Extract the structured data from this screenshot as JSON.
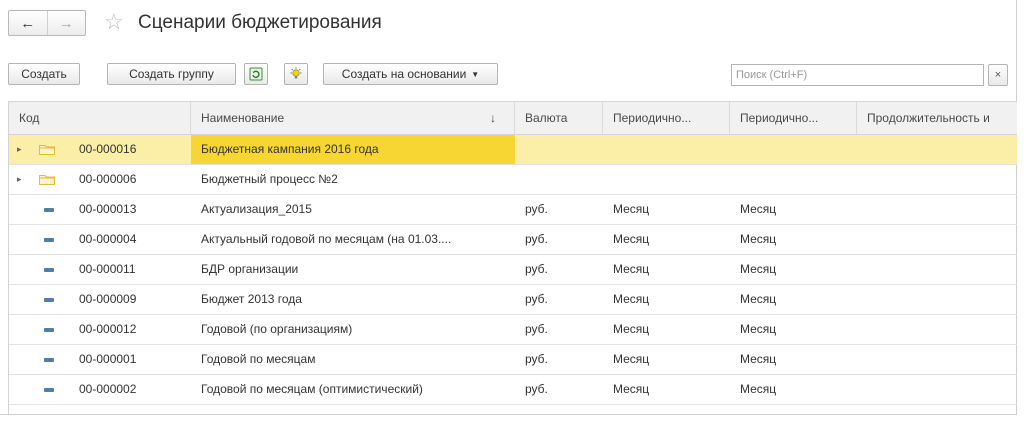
{
  "window": {
    "title": "Сценарии бюджетирования",
    "nav": {
      "back_label": "←",
      "forward_label": "→"
    }
  },
  "toolbar": {
    "create_label": "Создать",
    "create_group_label": "Создать группу",
    "create_based_on_label": "Создать на основании",
    "search_placeholder": "Поиск (Ctrl+F)",
    "search_clear_label": "×"
  },
  "table": {
    "columns": {
      "code": "Код",
      "name": "Наименование",
      "currency": "Валюта",
      "period1": "Периодично...",
      "period2": "Периодично...",
      "duration": "Продолжительность и"
    },
    "sort_indicator": "↓",
    "rows": [
      {
        "type": "group",
        "code": "00-000016",
        "name": "Бюджетная кампания 2016 года",
        "currency": "",
        "period1": "",
        "period2": "",
        "selected": true
      },
      {
        "type": "group",
        "code": "00-000006",
        "name": "Бюджетный процесс №2",
        "currency": "",
        "period1": "",
        "period2": ""
      },
      {
        "type": "item",
        "code": "00-000013",
        "name": "Актуализация_2015",
        "currency": "руб.",
        "period1": "Месяц",
        "period2": "Месяц"
      },
      {
        "type": "item",
        "code": "00-000004",
        "name": "Актуальный годовой по месяцам (на 01.03....",
        "currency": "руб.",
        "period1": "Месяц",
        "period2": "Месяц"
      },
      {
        "type": "item",
        "code": "00-000011",
        "name": "БДР организации",
        "currency": "руб.",
        "period1": "Месяц",
        "period2": "Месяц"
      },
      {
        "type": "item",
        "code": "00-000009",
        "name": "Бюджет 2013 года",
        "currency": "руб.",
        "period1": "Месяц",
        "period2": "Месяц"
      },
      {
        "type": "item",
        "code": "00-000012",
        "name": "Годовой (по организациям)",
        "currency": "руб.",
        "period1": "Месяц",
        "period2": "Месяц"
      },
      {
        "type": "item",
        "code": "00-000001",
        "name": "Годовой по месяцам",
        "currency": "руб.",
        "period1": "Месяц",
        "period2": "Месяц"
      },
      {
        "type": "item",
        "code": "00-000002",
        "name": "Годовой по месяцам (оптимистический)",
        "currency": "руб.",
        "period1": "Месяц",
        "period2": "Месяц"
      }
    ]
  },
  "colors": {
    "selected_row": "#fbeea6",
    "selected_cell": "#f7d633",
    "folder": "#e8b93a",
    "item_marker": "#4f7ea9"
  }
}
